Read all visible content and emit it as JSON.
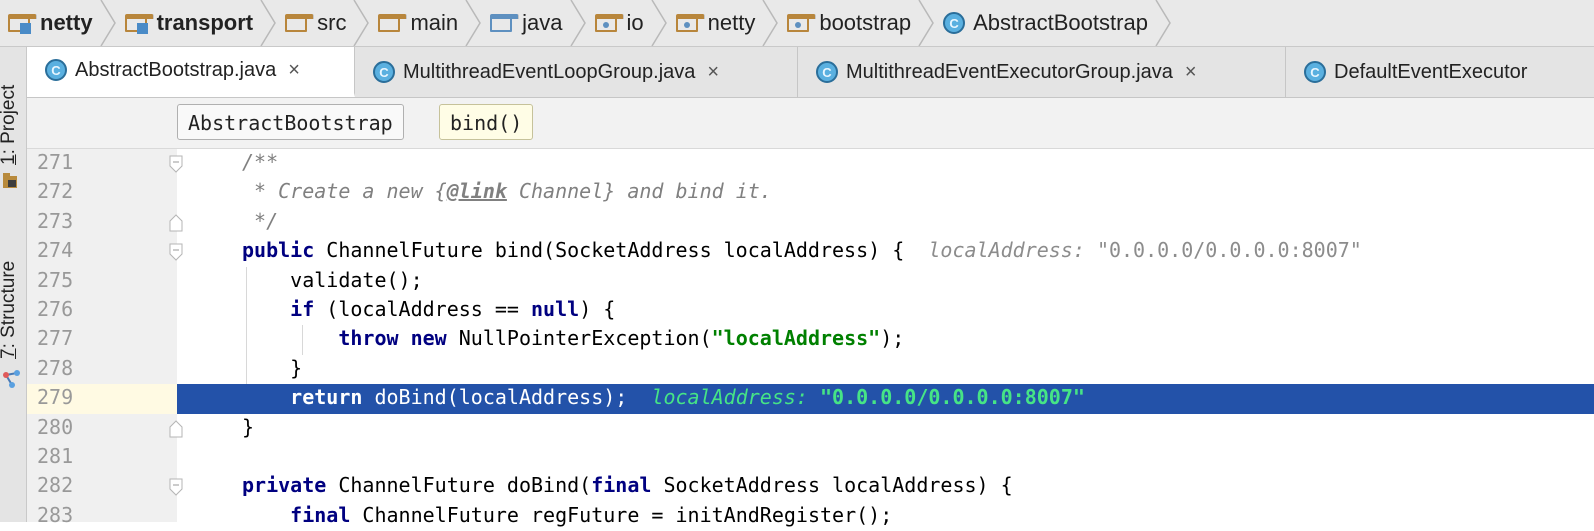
{
  "breadcrumb": [
    {
      "label": "netty",
      "icon": "module-folder-icon",
      "bold": true
    },
    {
      "label": "transport",
      "icon": "module-folder-icon",
      "bold": true
    },
    {
      "label": "src",
      "icon": "folder-icon",
      "bold": false
    },
    {
      "label": "main",
      "icon": "folder-icon",
      "bold": false
    },
    {
      "label": "java",
      "icon": "source-folder-icon",
      "bold": false
    },
    {
      "label": "io",
      "icon": "package-icon",
      "bold": false
    },
    {
      "label": "netty",
      "icon": "package-icon",
      "bold": false
    },
    {
      "label": "bootstrap",
      "icon": "package-icon",
      "bold": false
    },
    {
      "label": "AbstractBootstrap",
      "icon": "class-icon",
      "bold": false
    }
  ],
  "tool_windows": {
    "project": {
      "num": "1",
      "label": ": Project"
    },
    "structure": {
      "num": "7",
      "label": ": Structure"
    }
  },
  "tabs": [
    {
      "label": "AbstractBootstrap.java",
      "close": "×",
      "active": true
    },
    {
      "label": "MultithreadEventLoopGroup.java",
      "close": "×",
      "active": false
    },
    {
      "label": "MultithreadEventExecutorGroup.java",
      "close": "×",
      "active": false
    },
    {
      "label": "DefaultEventExecutor",
      "close": "",
      "active": false
    }
  ],
  "method_crumbs": {
    "class": "AbstractBootstrap",
    "method": "bind()"
  },
  "editor": {
    "highlight_color": "#2352a9",
    "lines": [
      {
        "n": "271"
      },
      {
        "n": "272"
      },
      {
        "n": "273"
      },
      {
        "n": "274"
      },
      {
        "n": "275"
      },
      {
        "n": "276"
      },
      {
        "n": "277"
      },
      {
        "n": "278"
      },
      {
        "n": "279"
      },
      {
        "n": "280"
      },
      {
        "n": "281"
      },
      {
        "n": "282"
      },
      {
        "n": "283"
      }
    ],
    "code": {
      "l271": "/**",
      "l272a": " * Create a new {",
      "l272b": "@link",
      "l272c": " Channel} and bind it.",
      "l273": " */",
      "l274a": "public",
      "l274b": " ChannelFuture bind(SocketAddress localAddress) {",
      "l274hint": "localAddress: ",
      "l274val": "\"0.0.0.0/0.0.0.0:8007\"",
      "l275": "    validate();",
      "l276a": "    ",
      "l276b": "if",
      "l276c": " (localAddress == ",
      "l276d": "null",
      "l276e": ") {",
      "l277a": "        ",
      "l277b": "throw",
      "l277c": " ",
      "l277d": "new",
      "l277e": " NullPointerException(",
      "l277f": "\"localAddress\"",
      "l277g": ");",
      "l278": "    }",
      "l279a": "    ",
      "l279b": "return",
      "l279c": " doBind(localAddress);",
      "l279hint": "localAddress: ",
      "l279val": "\"0.0.0.0/0.0.0.0:8007\"",
      "l280": "}",
      "l282a": "private",
      "l282b": " ChannelFuture doBind(",
      "l282c": "final",
      "l282d": " SocketAddress localAddress) {",
      "l283a": "    ",
      "l283b": "final",
      "l283c": " ChannelFuture regFuture = initAndRegister();"
    }
  }
}
